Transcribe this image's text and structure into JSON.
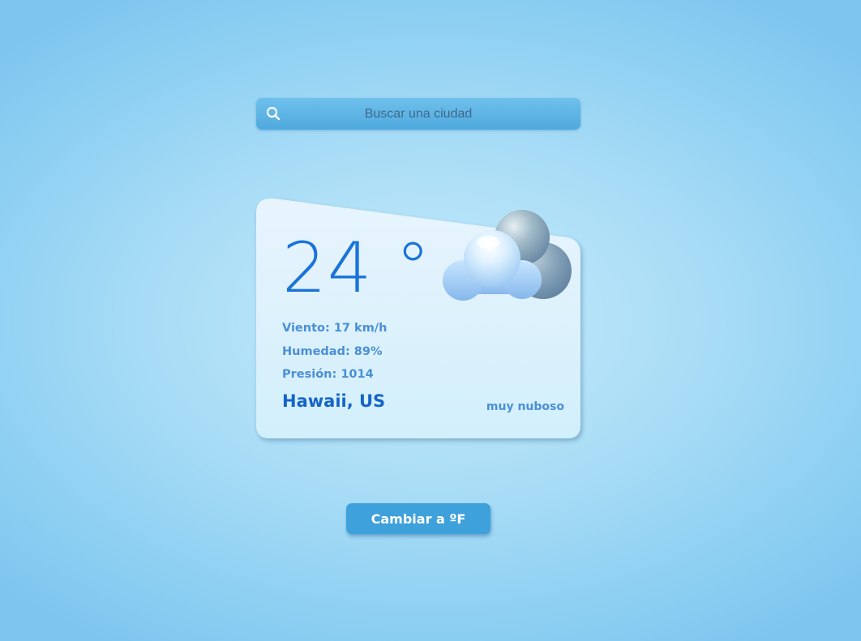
{
  "search": {
    "placeholder": "Buscar una ciudad",
    "icon": "search-icon"
  },
  "weather": {
    "temperature": "24 °",
    "details": {
      "wind": "Viento: 17 km/h",
      "humidity": "Humedad: 89%",
      "pressure": "Presión: 1014"
    },
    "location": "Hawaii, US",
    "condition": "muy nuboso",
    "illustration": "cloudy-icon"
  },
  "controls": {
    "toggle_unit_label": "Cambiar a ºF"
  },
  "colors": {
    "accent": "#1a73d9",
    "secondary_text": "#4a8fd6",
    "button": "#3ea1db",
    "search_bar": "#5ab3e3"
  }
}
